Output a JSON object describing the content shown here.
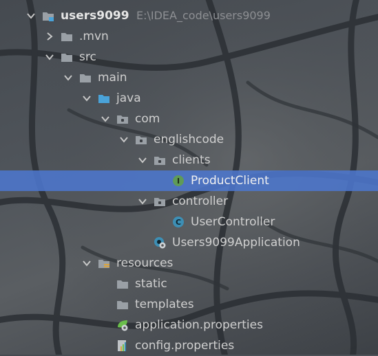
{
  "colors": {
    "folder": "#9aa0a6",
    "source_folder": "#4aa3d9",
    "resources_marker": "#d9a441",
    "interface_badge": "#5f9b57",
    "class_badge": "#3d8fb5",
    "spring_green": "#6abf4b",
    "selection": "#4c76cd"
  },
  "tree": [
    {
      "label": "users9099",
      "path": "E:\\IDEA_code\\users9099",
      "depth": 0,
      "arrow": "down",
      "icon": "module-folder-icon",
      "bold": true
    },
    {
      "label": ".mvn",
      "depth": 1,
      "arrow": "right",
      "icon": "folder-icon"
    },
    {
      "label": "src",
      "depth": 1,
      "arrow": "down",
      "icon": "folder-icon"
    },
    {
      "label": "main",
      "depth": 2,
      "arrow": "down",
      "icon": "folder-icon"
    },
    {
      "label": "java",
      "depth": 3,
      "arrow": "down",
      "icon": "source-folder-icon"
    },
    {
      "label": "com",
      "depth": 4,
      "arrow": "down",
      "icon": "package-icon"
    },
    {
      "label": "englishcode",
      "depth": 5,
      "arrow": "down",
      "icon": "package-icon"
    },
    {
      "label": "clients",
      "depth": 6,
      "arrow": "down",
      "icon": "package-icon"
    },
    {
      "label": "ProductClient",
      "depth": 7,
      "arrow": "none",
      "icon": "interface-icon",
      "badge": "I",
      "selected": true
    },
    {
      "label": "controller",
      "depth": 6,
      "arrow": "down",
      "icon": "package-icon"
    },
    {
      "label": "UserController",
      "depth": 7,
      "arrow": "none",
      "icon": "class-icon",
      "badge": "C"
    },
    {
      "label": "Users9099Application",
      "depth": 6,
      "arrow": "none",
      "icon": "spring-boot-class-icon"
    },
    {
      "label": "resources",
      "depth": 3,
      "arrow": "down",
      "icon": "resources-folder-icon"
    },
    {
      "label": "static",
      "depth": 4,
      "arrow": "none",
      "icon": "folder-icon"
    },
    {
      "label": "templates",
      "depth": 4,
      "arrow": "none",
      "icon": "folder-icon"
    },
    {
      "label": "application.properties",
      "depth": 4,
      "arrow": "none",
      "icon": "spring-properties-icon"
    },
    {
      "label": "config.properties",
      "depth": 4,
      "arrow": "none",
      "icon": "properties-file-icon"
    }
  ]
}
